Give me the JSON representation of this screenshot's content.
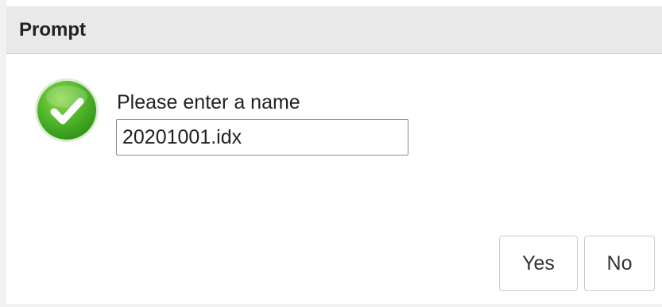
{
  "dialog": {
    "title": "Prompt",
    "message": "Please enter a name",
    "input_value": "20201001.idx",
    "status_icon": "checkmark-success-icon",
    "status_color": "#52b62a"
  },
  "buttons": {
    "yes_label": "Yes",
    "no_label": "No"
  }
}
